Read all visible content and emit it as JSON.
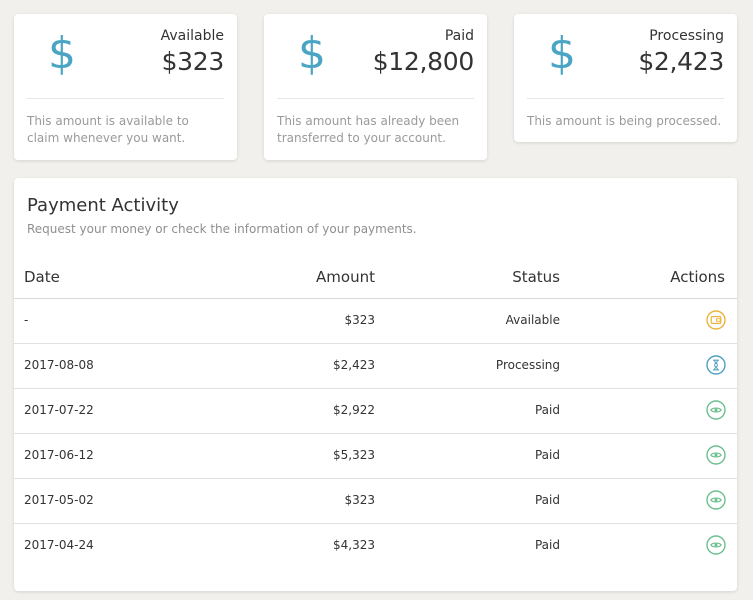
{
  "colors": {
    "background": "#f1f0ec",
    "dollar_icon": "#4aa5c4",
    "available_action": "#e9b43c",
    "processing_action": "#4fa0c0",
    "paid_action": "#6cbf8e"
  },
  "summary_cards": [
    {
      "icon": "dollar-icon",
      "label": "Available",
      "value": "$323",
      "description": "This amount is available to claim whenever you want."
    },
    {
      "icon": "dollar-icon",
      "label": "Paid",
      "value": "$12,800",
      "description": "This amount has already been transferred to your account."
    },
    {
      "icon": "dollar-icon",
      "label": "Processing",
      "value": "$2,423",
      "description": "This amount is being processed."
    }
  ],
  "activity": {
    "title": "Payment Activity",
    "subtitle": "Request your money or check the information of your payments.",
    "columns": {
      "date": "Date",
      "amount": "Amount",
      "status": "Status",
      "actions": "Actions"
    },
    "rows": [
      {
        "date": "-",
        "amount": "$323",
        "status": "Available",
        "action_icon": "wallet-icon"
      },
      {
        "date": "2017-08-08",
        "amount": "$2,423",
        "status": "Processing",
        "action_icon": "hourglass-icon"
      },
      {
        "date": "2017-07-22",
        "amount": "$2,922",
        "status": "Paid",
        "action_icon": "eye-icon"
      },
      {
        "date": "2017-06-12",
        "amount": "$5,323",
        "status": "Paid",
        "action_icon": "eye-icon"
      },
      {
        "date": "2017-05-02",
        "amount": "$323",
        "status": "Paid",
        "action_icon": "eye-icon"
      },
      {
        "date": "2017-04-24",
        "amount": "$4,323",
        "status": "Paid",
        "action_icon": "eye-icon"
      }
    ]
  }
}
